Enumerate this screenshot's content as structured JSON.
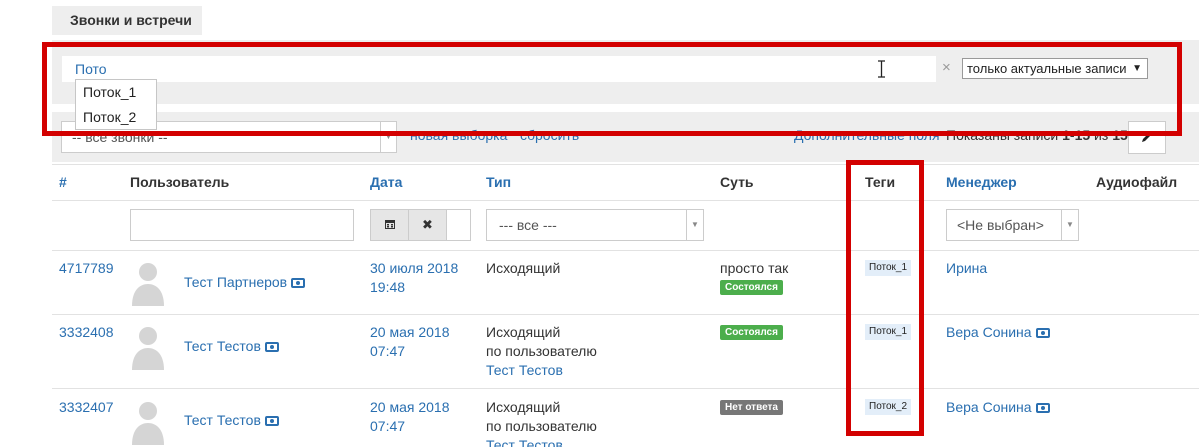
{
  "tab": {
    "label": "Звонки и встречи"
  },
  "filter": {
    "search_value": "Пото",
    "clear_symbol": "×",
    "records_select": "только актуальные записи",
    "suggestions": [
      "Поток_1",
      "Поток_2"
    ]
  },
  "toolbar": {
    "calls_select": "-- все звонки --",
    "new_selection": "новая выборка",
    "reset": "сбросить",
    "extra_fields": "Дополнительные поля",
    "shown_prefix": "Показаны записи ",
    "shown_range": "1-15",
    "shown_of": " из ",
    "shown_total": "15."
  },
  "table": {
    "headers": {
      "id": "#",
      "user": "Пользователь",
      "date": "Дата",
      "type": "Тип",
      "essence": "Суть",
      "tags": "Теги",
      "manager": "Менеджер",
      "audio": "Аудиофайл"
    },
    "filters": {
      "type_placeholder": "--- все ---",
      "manager_placeholder": "<Не выбран>"
    },
    "rows": [
      {
        "id": "4717789",
        "user": "Тест Партнеров",
        "date": "30 июля 2018",
        "time": "19:48",
        "type": "Исходящий",
        "type_sub": "",
        "type_user": "",
        "essence": "просто так",
        "status": "Состоялся",
        "tag": "Поток_1",
        "manager": "Ирина"
      },
      {
        "id": "3332408",
        "user": "Тест Тестов",
        "date": "20 мая 2018",
        "time": "07:47",
        "type": "Исходящий",
        "type_sub": "по пользователю",
        "type_user": "Тест Тестов",
        "essence": "",
        "status": "Состоялся",
        "tag": "Поток_1",
        "manager": "Вера Сонина"
      },
      {
        "id": "3332407",
        "user": "Тест Тестов",
        "date": "20 мая 2018",
        "time": "07:47",
        "type": "Исходящий",
        "type_sub": "по пользователю",
        "type_user": "Тест Тестов",
        "essence": "",
        "status": "Нет ответа",
        "tag": "Поток_2",
        "manager": "Вера Сонина"
      }
    ]
  }
}
